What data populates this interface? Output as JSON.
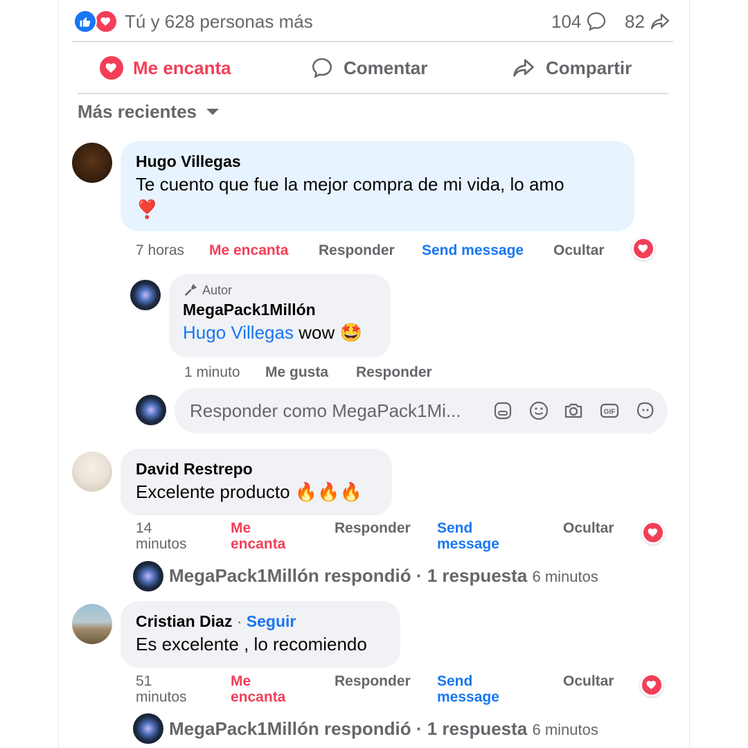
{
  "stats": {
    "reactions_text": "Tú y 628 personas más",
    "comments_count": "104",
    "shares_count": "82"
  },
  "actions": {
    "love": "Me encanta",
    "comment": "Comentar",
    "share": "Compartir"
  },
  "sort": {
    "label": "Más recientes"
  },
  "comments": [
    {
      "author": "Hugo Villegas",
      "text": "Te cuento que fue la mejor compra de mi vida, lo amo",
      "emoji": "❣️",
      "time": "7 horas",
      "love_label": "Me encanta",
      "reply_label": "Responder",
      "message_label": "Send message",
      "hide_label": "Ocultar",
      "reply": {
        "badge": "Autor",
        "author": "MegaPack1Millón",
        "mention": "Hugo Villegas",
        "text": "wow",
        "emoji": "🤩",
        "time": "1 minuto",
        "like_label": "Me gusta",
        "reply_label": "Responder"
      }
    },
    {
      "author": "David Restrepo",
      "text": "Excelente producto",
      "emoji": "🔥🔥🔥",
      "time_line1": "14",
      "time_line2": "minutos",
      "love_line1": "Me",
      "love_line2": "encanta",
      "reply_label": "Responder",
      "message_line1": "Send",
      "message_line2": "message",
      "hide_label": "Ocultar",
      "replied": {
        "text": "MegaPack1Millón respondió · 1 respuesta",
        "time": "6 minutos"
      }
    },
    {
      "author": "Cristian Diaz",
      "separator": "·",
      "follow": "Seguir",
      "text": "Es excelente , lo recomiendo",
      "time_line1": "51",
      "time_line2": "minutos",
      "love_line1": "Me",
      "love_line2": "encanta",
      "reply_label": "Responder",
      "message_line1": "Send",
      "message_line2": "message",
      "hide_label": "Ocultar",
      "replied": {
        "text": "MegaPack1Millón respondió · 1 respuesta",
        "time": "6 minutos"
      }
    }
  ],
  "reply_box": {
    "placeholder": "Responder como MegaPack1Mi..."
  },
  "colors": {
    "love": "#f33e58",
    "like": "#1877f2",
    "link": "#1877f2",
    "muted": "#65676b",
    "bubble": "#f0f2f5",
    "highlight": "#e7f3ff"
  },
  "icons": [
    "like-icon",
    "love-icon",
    "comment-icon",
    "share-icon",
    "caret-down-icon",
    "mic-icon",
    "sticker-icon",
    "emoji-icon",
    "camera-icon",
    "gif-icon",
    "avatar-sticker-icon"
  ]
}
